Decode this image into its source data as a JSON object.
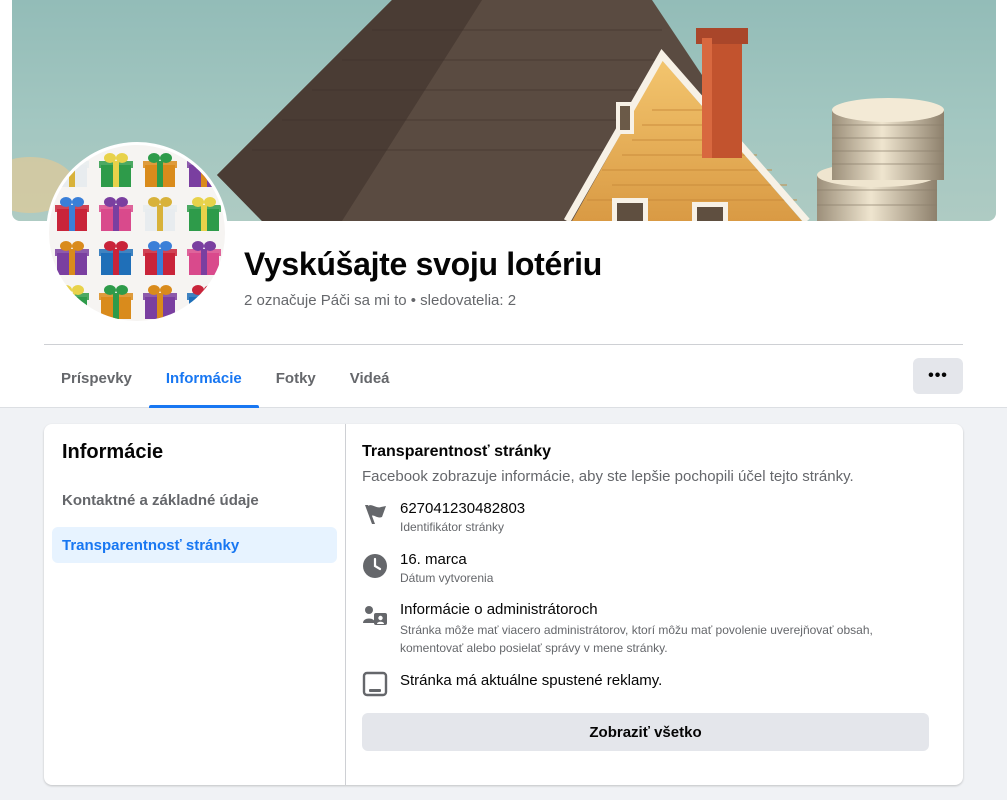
{
  "page": {
    "name": "Vyskúšajte svoju lotériu",
    "stats": "2 označuje Páči sa mi to • sledovatelia: 2"
  },
  "tabs": [
    {
      "label": "Príspevky",
      "active": false
    },
    {
      "label": "Informácie",
      "active": true
    },
    {
      "label": "Fotky",
      "active": false
    },
    {
      "label": "Videá",
      "active": false
    }
  ],
  "more_button": {
    "label": "•••",
    "icon": "more-icon"
  },
  "about": {
    "title": "Informácie",
    "items": [
      {
        "label": "Kontaktné a základné údaje",
        "selected": false
      },
      {
        "label": "Transparentnosť stránky",
        "selected": true
      }
    ]
  },
  "transparency": {
    "title": "Transparentnosť stránky",
    "subtitle": "Facebook zobrazuje informácie, aby ste lepšie pochopili účel tejto stránky.",
    "page_id": {
      "value": "627041230482803",
      "label": "Identifikátor stránky",
      "icon": "flag-icon"
    },
    "created": {
      "value": "16. marca",
      "label": "Dátum vytvorenia",
      "icon": "clock-icon"
    },
    "admins": {
      "title": "Informácie o administrátoroch",
      "description": "Stránka môže mať viacero administrátorov, ktorí môžu mať povolenie uverejňovať obsah, komentovať alebo posielať správy v mene stránky.",
      "icon": "admins-icon"
    },
    "ads": {
      "text": "Stránka má aktuálne spustené reklamy.",
      "icon": "ads-icon"
    },
    "see_all": "Zobraziť všetko"
  },
  "colors": {
    "accent": "#1877f2",
    "secondary_text": "#65676b",
    "background": "#f0f2f5",
    "button_gray": "#e4e6eb",
    "selected_bg": "#e7f3ff"
  }
}
